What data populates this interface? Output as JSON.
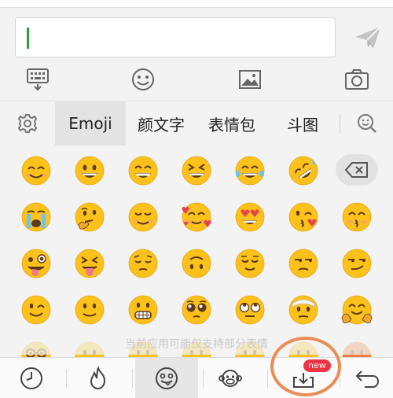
{
  "input": {
    "value": ""
  },
  "tabs": [
    {
      "label": "Emoji",
      "active": true
    },
    {
      "label": "颜文字",
      "active": false
    },
    {
      "label": "表情包",
      "active": false
    },
    {
      "label": "斗图",
      "active": false
    }
  ],
  "notice": "当前应用可能仅支持部分表情",
  "badge": "new",
  "colors": {
    "caret": "#2f9e3e",
    "highlight_ring": "#ea8c55",
    "badge": "#ee3344",
    "emoji_face": "#fcc21b"
  },
  "icons": {
    "send": "send-icon",
    "keyboard_hide": "keyboard-hide-icon",
    "smiley": "smiley-icon",
    "image": "image-icon",
    "camera": "camera-icon",
    "settings": "gear-icon",
    "search_emoji": "search-emoji-icon",
    "delete": "delete-icon",
    "recent": "clock-icon",
    "hot": "flame-icon",
    "emoji_category": "emoji-category-icon",
    "monkey": "monkey-icon",
    "download": "download-icon",
    "back": "back-icon"
  }
}
